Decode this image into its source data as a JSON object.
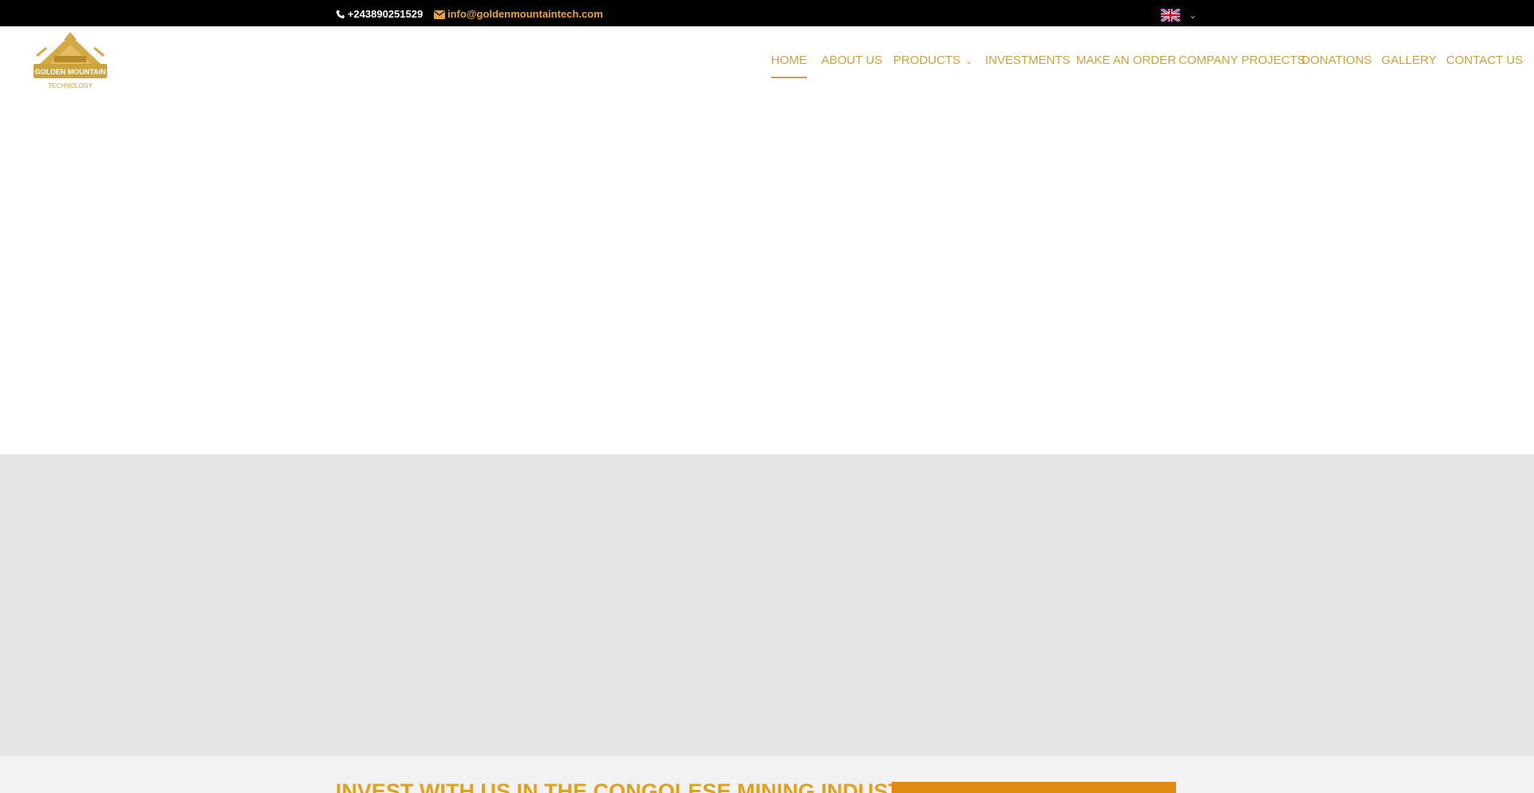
{
  "topbar": {
    "phone": "+243890251529",
    "email": "info@goldenmountaintech.com",
    "language_flag": "uk-flag-icon"
  },
  "logo": {
    "line1": "GOLDEN MOUNTAIN",
    "line2": "TECHNOLOGY"
  },
  "nav": {
    "items": [
      {
        "label": "HOME",
        "active": true
      },
      {
        "label": "ABOUT US"
      },
      {
        "label": "PRODUCTS",
        "has_dropdown": true
      },
      {
        "label": "INVESTMENTS"
      },
      {
        "label": "MAKE AN ORDER"
      },
      {
        "label": "COMPANY PROJECTS"
      },
      {
        "label": "DONATIONS"
      },
      {
        "label": "GALLERY"
      },
      {
        "label": "CONTACT US"
      }
    ]
  },
  "invest_section": {
    "title": "INVEST WITH US IN THE CONGOLESE MINING INDUSTRY"
  },
  "colors": {
    "gold": "#c9a33c",
    "orange": "#e08a12",
    "email_orange": "#e8a43a",
    "topbar": "#000000",
    "grey_band": "#e5e5e5"
  }
}
